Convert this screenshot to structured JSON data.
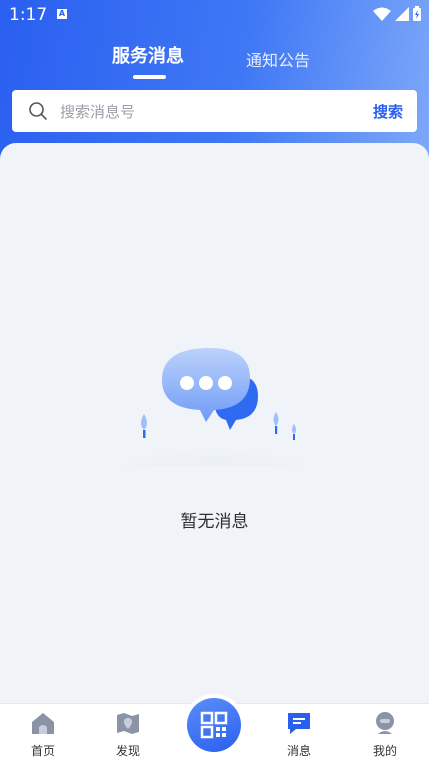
{
  "status_bar": {
    "time": "1:17",
    "app_indicator": "A"
  },
  "tabs": [
    {
      "label": "服务消息",
      "active": true
    },
    {
      "label": "通知公告",
      "active": false
    }
  ],
  "search": {
    "placeholder": "搜索消息号",
    "button_label": "搜索"
  },
  "empty_state": {
    "text": "暂无消息"
  },
  "bottom_nav": {
    "items": [
      {
        "label": "首页",
        "icon": "home-icon"
      },
      {
        "label": "发现",
        "icon": "map-icon"
      },
      {
        "label": "",
        "icon": "qr-scan-icon"
      },
      {
        "label": "消息",
        "icon": "message-icon",
        "active": true
      },
      {
        "label": "我的",
        "icon": "profile-icon"
      }
    ]
  },
  "colors": {
    "primary": "#2a5ff0",
    "background": "#f0f3f7"
  }
}
